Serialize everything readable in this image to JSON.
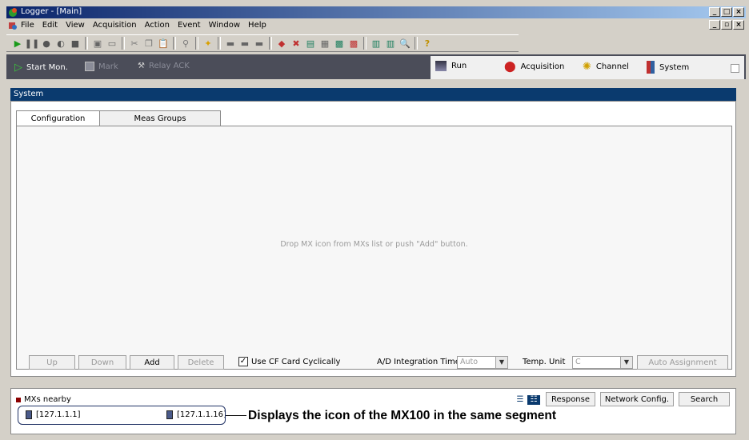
{
  "window": {
    "title": "Logger - [Main]"
  },
  "menu": [
    "File",
    "Edit",
    "View",
    "Acquisition",
    "Action",
    "Event",
    "Window",
    "Help"
  ],
  "commands": {
    "start": "Start Mon.",
    "mark": "Mark",
    "relay": "Relay ACK"
  },
  "tabs": {
    "run": "Run",
    "acquisition": "Acquisition",
    "channel": "Channel",
    "system": "System"
  },
  "system": {
    "header": "System",
    "tab_configuration": "Configuration",
    "tab_meas_groups": "Meas Groups",
    "hint": "Drop MX icon from MXs list or push \"Add\" button.",
    "btn_up": "Up",
    "btn_down": "Down",
    "btn_add": "Add",
    "btn_delete": "Delete",
    "use_cf_label": "Use CF Card Cyclically",
    "use_cf_checked": true,
    "ad_label": "A/D Integration Time",
    "ad_value": "Auto",
    "temp_label": "Temp. Unit",
    "temp_value": "C",
    "auto_assign": "Auto Assignment"
  },
  "mx": {
    "title": "MXs nearby",
    "btn_response": "Response",
    "btn_network": "Network Config.",
    "btn_search": "Search",
    "items": [
      "[127.1.1.1]",
      "[127.1.1.16]"
    ],
    "caption": "Displays the icon of the MX100 in the same segment"
  },
  "colors": {
    "title_bar": "#0a246a",
    "command_strip": "#4b4d59",
    "panel_header": "#0a3a6e"
  }
}
